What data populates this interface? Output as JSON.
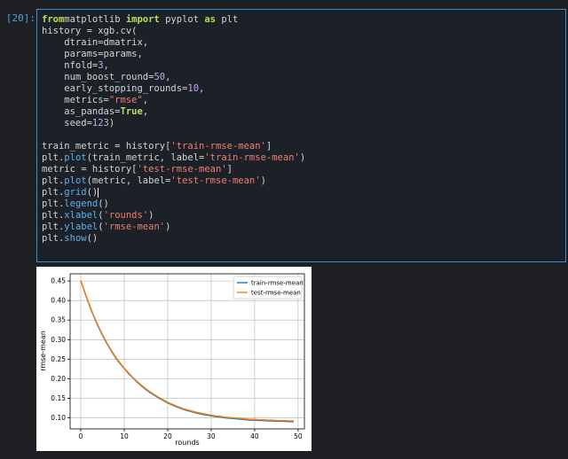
{
  "prompt": "[20]:",
  "code_lines": [
    [
      [
        "kw",
        "from"
      ],
      [
        "",
        "matplotlib "
      ],
      [
        "kw",
        "import"
      ],
      [
        "",
        " pyplot "
      ],
      [
        "kw",
        "as"
      ],
      [
        "",
        " plt"
      ]
    ],
    [
      [
        "",
        "history = xgb.cv("
      ]
    ],
    [
      [
        "",
        "    dtrain=dmatrix,"
      ]
    ],
    [
      [
        "",
        "    params=params,"
      ]
    ],
    [
      [
        "",
        "    nfold="
      ],
      [
        "num",
        "3"
      ],
      [
        "",
        ","
      ]
    ],
    [
      [
        "",
        "    num_boost_round="
      ],
      [
        "num",
        "50"
      ],
      [
        "",
        ","
      ]
    ],
    [
      [
        "",
        "    early_stopping_rounds="
      ],
      [
        "num",
        "10"
      ],
      [
        "",
        ","
      ]
    ],
    [
      [
        "",
        "    metrics="
      ],
      [
        "str",
        "\"rmse\""
      ],
      [
        "",
        ","
      ]
    ],
    [
      [
        "",
        "    as_pandas="
      ],
      [
        "kw",
        "True"
      ],
      [
        "",
        ","
      ]
    ],
    [
      [
        "",
        "    seed="
      ],
      [
        "num",
        "123"
      ],
      [
        "",
        ")"
      ]
    ],
    [
      [
        "",
        ""
      ]
    ],
    [
      [
        "",
        "train_metric = history["
      ],
      [
        "str",
        "'train-rmse-mean'"
      ],
      [
        "",
        "]"
      ]
    ],
    [
      [
        "",
        "plt."
      ],
      [
        "fn",
        "plot"
      ],
      [
        "",
        "(train_metric, label="
      ],
      [
        "str",
        "'train-rmse-mean'"
      ],
      [
        "",
        ")"
      ]
    ],
    [
      [
        "",
        "metric = history["
      ],
      [
        "str",
        "'test-rmse-mean'"
      ],
      [
        "",
        "]"
      ]
    ],
    [
      [
        "",
        "plt."
      ],
      [
        "fn",
        "plot"
      ],
      [
        "",
        "(metric, label="
      ],
      [
        "str",
        "'test-rmse-mean'"
      ],
      [
        "",
        ")"
      ]
    ],
    [
      [
        "",
        "plt."
      ],
      [
        "fn",
        "grid"
      ],
      [
        "",
        "()"
      ],
      [
        "cursor",
        ""
      ]
    ],
    [
      [
        "",
        "plt."
      ],
      [
        "fn",
        "legend"
      ],
      [
        "",
        "()"
      ]
    ],
    [
      [
        "",
        "plt."
      ],
      [
        "fn",
        "xlabel"
      ],
      [
        "",
        "("
      ],
      [
        "str",
        "'rounds'"
      ],
      [
        "",
        ")"
      ]
    ],
    [
      [
        "",
        "plt."
      ],
      [
        "fn",
        "ylabel"
      ],
      [
        "",
        "("
      ],
      [
        "str",
        "'rmse-mean'"
      ],
      [
        "",
        ")"
      ]
    ],
    [
      [
        "",
        "plt."
      ],
      [
        "fn",
        "show"
      ],
      [
        "",
        "()"
      ]
    ]
  ],
  "colors": {
    "train": "#1f77b4",
    "test": "#ff7f0e",
    "cell_border": "#3a8ed1"
  },
  "chart_data": {
    "type": "line",
    "xlabel": "rounds",
    "ylabel": "rmse-mean",
    "xlim": [
      -2.45,
      51.45
    ],
    "ylim": [
      0.0716,
      0.4684
    ],
    "xticks": [
      0,
      10,
      20,
      30,
      40,
      50
    ],
    "yticks": [
      0.1,
      0.15,
      0.2,
      0.25,
      0.3,
      0.35,
      0.4,
      0.45
    ],
    "grid": true,
    "legend_position": "top-right",
    "x": [
      0,
      1,
      2,
      3,
      4,
      5,
      6,
      7,
      8,
      9,
      10,
      11,
      12,
      13,
      14,
      15,
      16,
      17,
      18,
      19,
      20,
      21,
      22,
      23,
      24,
      25,
      26,
      27,
      28,
      29,
      30,
      31,
      32,
      33,
      34,
      35,
      36,
      37,
      38,
      39,
      40,
      41,
      42,
      43,
      44,
      45,
      46,
      47,
      48,
      49
    ],
    "series": [
      {
        "name": "train-rmse-mean",
        "values": [
          0.451,
          0.418,
          0.387,
          0.359,
          0.334,
          0.311,
          0.29,
          0.271,
          0.254,
          0.239,
          0.226,
          0.213,
          0.202,
          0.191,
          0.181,
          0.172,
          0.164,
          0.157,
          0.15,
          0.144,
          0.138,
          0.133,
          0.128,
          0.124,
          0.12,
          0.117,
          0.114,
          0.111,
          0.109,
          0.107,
          0.105,
          0.103,
          0.102,
          0.1,
          0.099,
          0.098,
          0.097,
          0.096,
          0.095,
          0.094,
          0.094,
          0.093,
          0.093,
          0.092,
          0.092,
          0.091,
          0.091,
          0.091,
          0.09,
          0.09
        ]
      },
      {
        "name": "test-rmse-mean",
        "values": [
          0.452,
          0.42,
          0.389,
          0.361,
          0.336,
          0.313,
          0.292,
          0.273,
          0.256,
          0.241,
          0.227,
          0.215,
          0.203,
          0.193,
          0.183,
          0.174,
          0.166,
          0.159,
          0.152,
          0.146,
          0.14,
          0.135,
          0.13,
          0.126,
          0.122,
          0.119,
          0.116,
          0.113,
          0.111,
          0.109,
          0.107,
          0.105,
          0.104,
          0.102,
          0.101,
          0.1,
          0.099,
          0.098,
          0.097,
          0.096,
          0.096,
          0.095,
          0.095,
          0.094,
          0.094,
          0.093,
          0.093,
          0.093,
          0.092,
          0.092
        ]
      }
    ]
  }
}
